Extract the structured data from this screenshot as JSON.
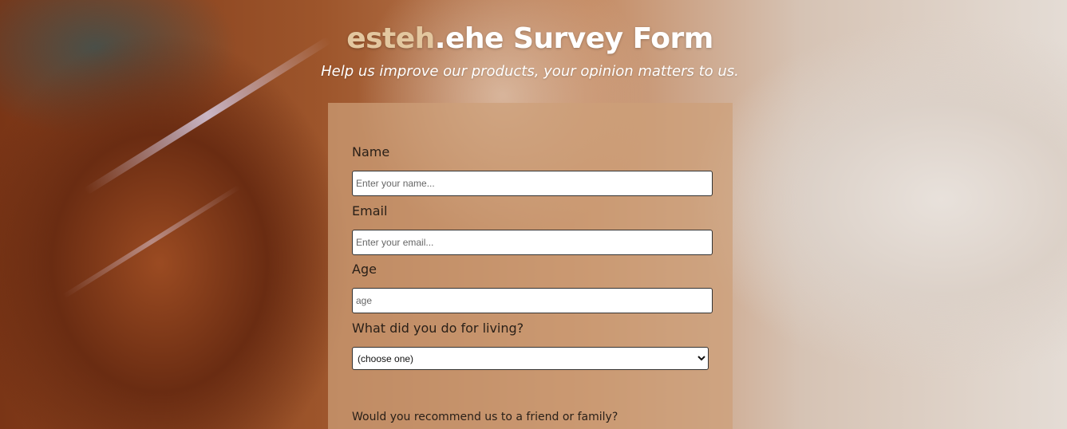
{
  "header": {
    "title_brand": "esteh",
    "title_rest": ".ehe Survey Form",
    "subtitle": "Help us improve our products, your opinion matters to us."
  },
  "form": {
    "name_label": "Name",
    "name_placeholder": "Enter your name...",
    "email_label": "Email",
    "email_placeholder": "Enter your email...",
    "age_label": "Age",
    "age_placeholder": "age",
    "occupation_label": "What did you do for living?",
    "occupation_selected": "(choose one)",
    "recommend_label": "Would you recommend us to a friend or family?"
  },
  "colors": {
    "brand_accent": "#e3c79f",
    "panel": "#cda078"
  }
}
